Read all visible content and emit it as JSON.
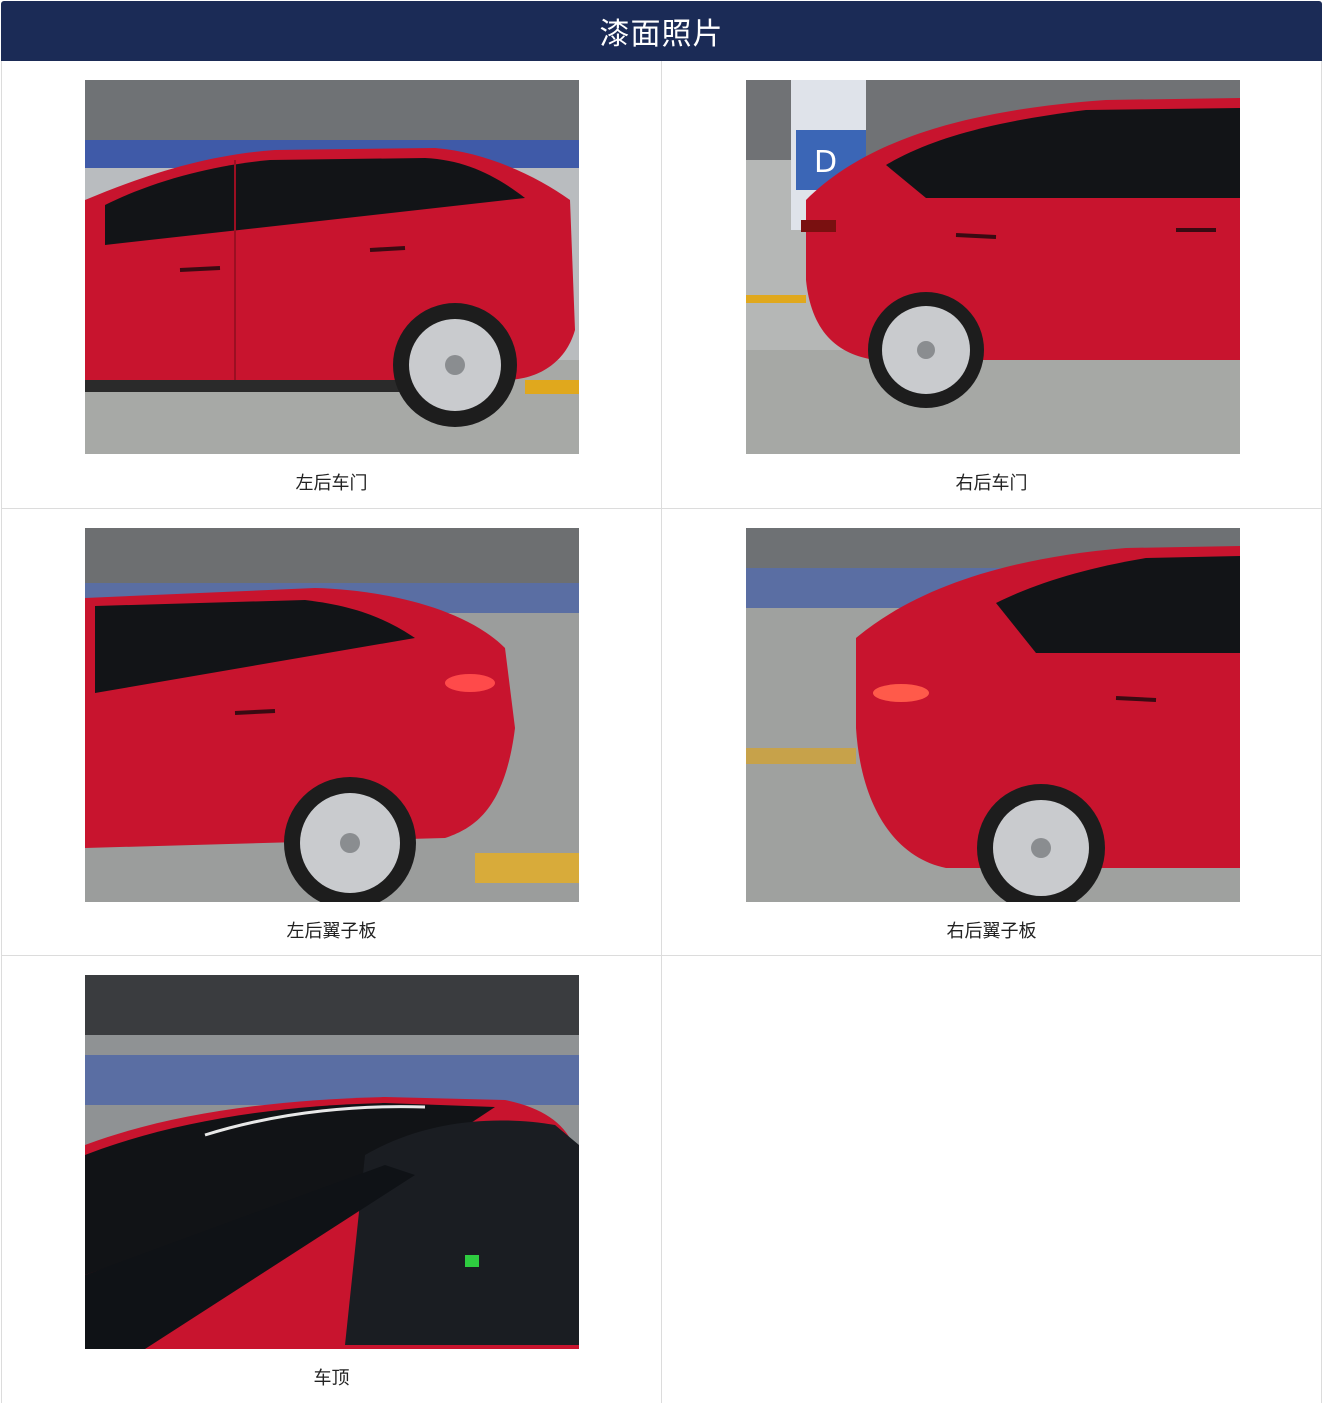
{
  "header": {
    "title": "漆面照片"
  },
  "photos": [
    {
      "caption": "左后车门",
      "subject": "left-rear-door"
    },
    {
      "caption": "右后车门",
      "subject": "right-rear-door"
    },
    {
      "caption": "左后翼子板",
      "subject": "left-rear-fender"
    },
    {
      "caption": "右后翼子板",
      "subject": "right-rear-fender"
    },
    {
      "caption": "车顶",
      "subject": "roof"
    }
  ],
  "colors": {
    "header_bg": "#1b2b56",
    "car_red": "#c8142e",
    "border": "#dcdcdc"
  }
}
